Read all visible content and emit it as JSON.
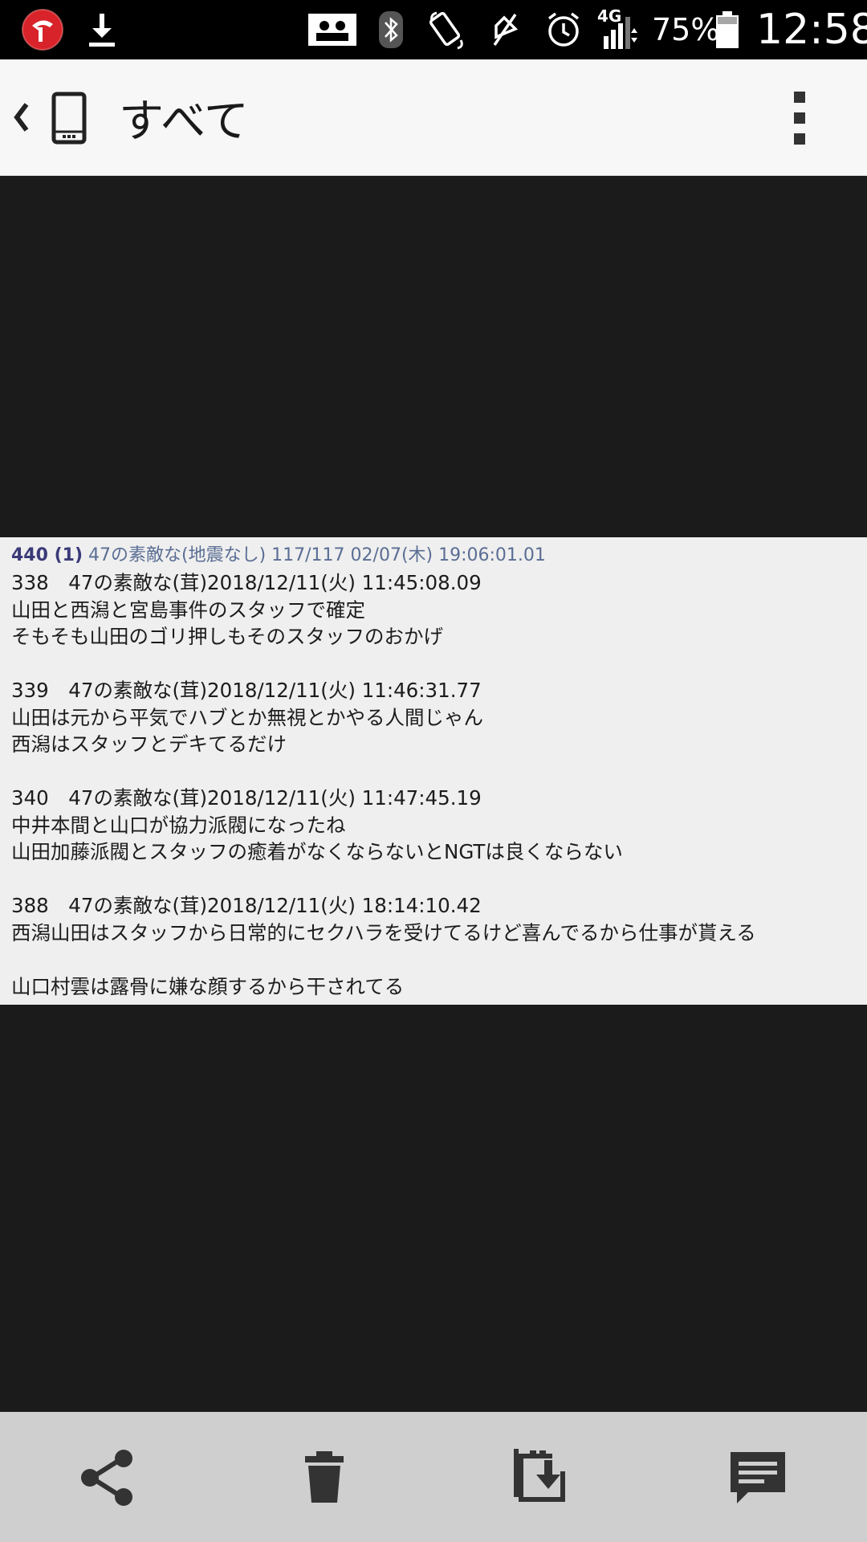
{
  "status_bar": {
    "network": "4G",
    "battery": "75%",
    "time": "12:58",
    "icons": [
      "trend-micro-icon",
      "download-icon",
      "sim-card-icon",
      "bluetooth-icon",
      "screen-rotate-icon",
      "mute-icon",
      "alarm-icon",
      "signal-icon",
      "battery-icon"
    ]
  },
  "app_bar": {
    "title": "すべて"
  },
  "post": {
    "header_number": "440 (1)",
    "header_meta": "47の素敵な(地震なし) 117/117  02/07(木) 19:06:01.01",
    "replies": [
      {
        "header": "338　47の素敵な(茸)2018/12/11(火) 11:45:08.09",
        "lines": [
          "山田と西潟と宮島事件のスタッフで確定",
          "そもそも山田のゴリ押しもそのスタッフのおかげ"
        ]
      },
      {
        "header": "339　47の素敵な(茸)2018/12/11(火) 11:46:31.77",
        "lines": [
          "山田は元から平気でハブとか無視とかやる人間じゃん",
          "西潟はスタッフとデキてるだけ"
        ]
      },
      {
        "header": "340　47の素敵な(茸)2018/12/11(火) 11:47:45.19",
        "lines": [
          "中井本間と山口が協力派閥になったね",
          "山田加藤派閥とスタッフの癒着がなくならないとNGTは良くならない"
        ]
      },
      {
        "header": "388　47の素敵な(茸)2018/12/11(火) 18:14:10.42",
        "lines": [
          "西潟山田はスタッフから日常的にセクハラを受けてるけど喜んでるから仕事が貰える",
          "",
          "山口村雲は露骨に嫌な顔するから干されてる"
        ]
      }
    ]
  },
  "bottom_bar": {
    "icons": [
      "share-icon",
      "delete-icon",
      "save-icon",
      "comment-icon"
    ]
  },
  "colors": {
    "status_bar_bg": "#000000",
    "app_bar_bg": "#f7f7f7",
    "viewer_bg": "#1b1b1b",
    "bottom_bar_bg": "#cfcfcf",
    "post_bg": "#efefef"
  }
}
